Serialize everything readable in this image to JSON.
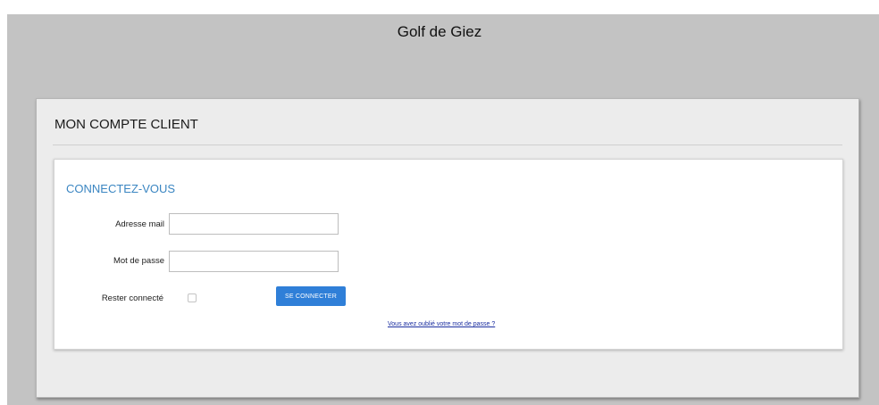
{
  "header": {
    "title": "Golf de Giez"
  },
  "account": {
    "heading": "MON COMPTE CLIENT",
    "login": {
      "title": "CONNECTEZ-VOUS",
      "email_label": "Adresse mail",
      "email_value": "",
      "password_label": "Mot de passe",
      "password_value": "",
      "remember_label": "Rester connecté",
      "remember_checked": false,
      "submit_label": "SE CONNECTER",
      "forgot_link": "Vous avez oublié votre mot de passe ?"
    }
  },
  "colors": {
    "page_background": "#c3c3c3",
    "title_accent": "#3b86c2",
    "button": "#2f7fd8",
    "link": "#1b2ea0"
  }
}
